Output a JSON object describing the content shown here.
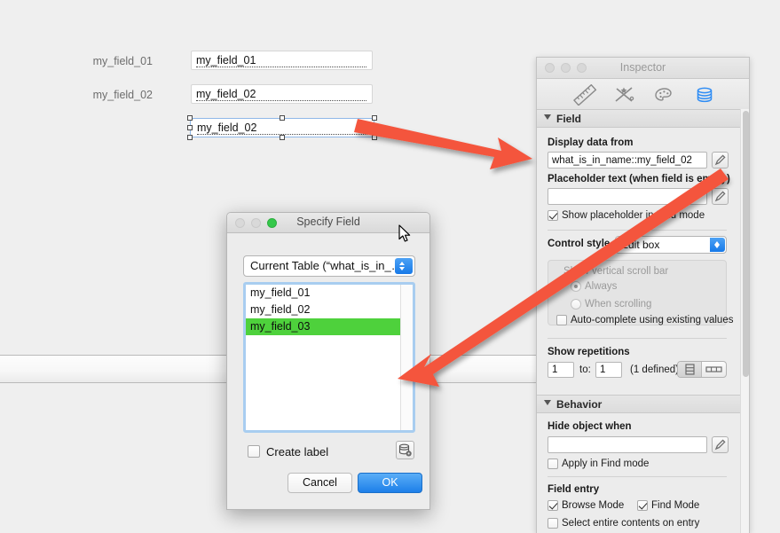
{
  "layout": {
    "fields": [
      {
        "label": "my_field_01",
        "value": "my_field_01"
      },
      {
        "label": "my_field_02",
        "value": "my_field_02"
      }
    ],
    "selected_object": {
      "value": "my_field_02"
    }
  },
  "inspector": {
    "window_title": "Inspector",
    "tabs": [
      {
        "name": "position-tab",
        "icon": "ruler-icon",
        "active": false
      },
      {
        "name": "styles-tab",
        "icon": "wand-icon",
        "active": false
      },
      {
        "name": "appearance-tab",
        "icon": "palette-icon",
        "active": false
      },
      {
        "name": "data-tab",
        "icon": "database-icon",
        "active": true
      }
    ],
    "field_section": {
      "title": "Field",
      "display_data_from_label": "Display data from",
      "display_data_from_value": "what_is_in_name::my_field_02",
      "placeholder_label": "Placeholder text (when field is empty)",
      "placeholder_value": "",
      "show_placeholder_label": "Show placeholder in Find mode",
      "show_placeholder_checked": true,
      "control_style_label": "Control style",
      "control_style_value": "Edit box",
      "show_vertical_scroll_bar_label": "Show vertical scroll bar",
      "always_label": "Always",
      "when_scrolling_label": "When scrolling",
      "autocomplete_label": "Auto-complete using existing values",
      "autocomplete_checked": false,
      "show_repetitions_label": "Show repetitions",
      "rep_from": "1",
      "rep_to_label": "to:",
      "rep_to": "1",
      "rep_defined": "(1 defined)"
    },
    "behavior_section": {
      "title": "Behavior",
      "hide_object_when_label": "Hide object when",
      "hide_object_when_value": "",
      "apply_in_find_mode_label": "Apply in Find mode",
      "apply_in_find_mode_checked": false,
      "field_entry_label": "Field entry",
      "browse_mode_label": "Browse Mode",
      "browse_mode_checked": true,
      "find_mode_label": "Find Mode",
      "find_mode_checked": true,
      "select_entire_label": "Select entire contents on entry",
      "select_entire_checked": false
    }
  },
  "dialog": {
    "title": "Specify Field",
    "table_popup_value": "Current Table (“what_is_in_…",
    "fields": [
      {
        "name": "my_field_01",
        "selected": false
      },
      {
        "name": "my_field_02",
        "selected": false
      },
      {
        "name": "my_field_03",
        "selected": true
      }
    ],
    "create_label_text": "Create label",
    "create_label_checked": false,
    "cancel_label": "Cancel",
    "ok_label": "OK"
  },
  "colors": {
    "annotation_arrow": "#f4543c",
    "selection_highlight": "#4ed13c",
    "accent_blue": "#1d7fe9",
    "window_bg": "#ececec",
    "canvas_bg": "#efefef"
  }
}
